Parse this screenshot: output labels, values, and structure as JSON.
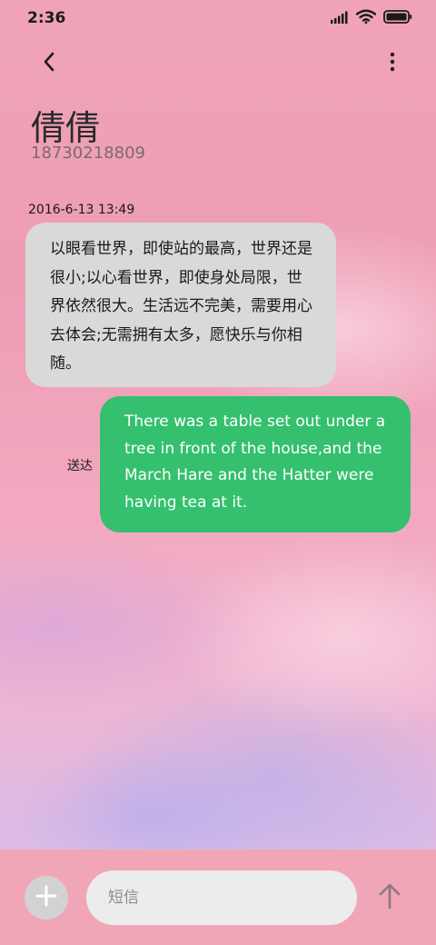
{
  "status_bar": {
    "time": "2:36",
    "icons": [
      "signal-icon",
      "wifi-icon",
      "battery-icon"
    ]
  },
  "header": {
    "back_icon": "chevron-left-icon",
    "more_icon": "more-vertical-icon",
    "contact_name": "倩倩",
    "contact_number": "18730218809"
  },
  "messages": {
    "timestamp": "2016-6-13 13:49",
    "incoming": {
      "text": "以眼看世界，即使站的最高，世界还是很小;以心看世界，即使身处局限，世界依然很大。生活远不完美，需要用心去体会;无需拥有太多，愿快乐与你相随。"
    },
    "outgoing": {
      "text": "There was a table set out under a tree in front of the house,and the March Hare and the Hatter were having tea at it.",
      "status": "送达"
    }
  },
  "composer": {
    "add_icon": "plus-icon",
    "placeholder": "短信",
    "send_icon": "arrow-up-icon"
  },
  "colors": {
    "incoming_bubble": "#d9d9d9",
    "outgoing_bubble": "#34c06e",
    "composer_bar": "#f0a6b6"
  }
}
